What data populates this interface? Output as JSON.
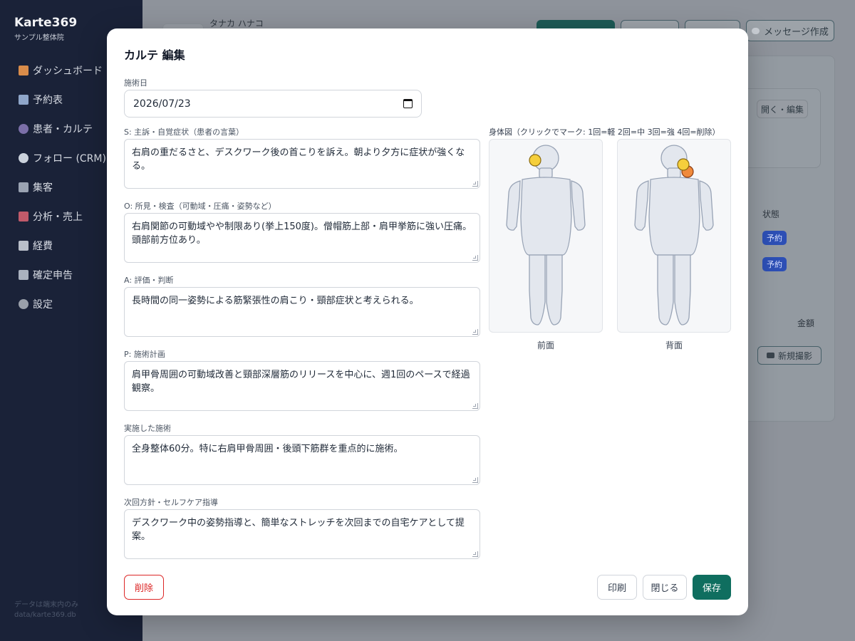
{
  "app": {
    "name": "Karte369",
    "clinic": "サンプル整体院",
    "footer_line1": "データは端末内のみ",
    "footer_line2": "data/karte369.db"
  },
  "sidebar": {
    "items": [
      {
        "label": "ダッシュボード",
        "icon": "house-icon"
      },
      {
        "label": "予約表",
        "icon": "calendar-icon"
      },
      {
        "label": "患者・カルテ",
        "icon": "people-icon"
      },
      {
        "label": "フォロー (CRM)",
        "icon": "chat-icon"
      },
      {
        "label": "集客",
        "icon": "trend-icon"
      },
      {
        "label": "分析・売上",
        "icon": "bar-chart-icon"
      },
      {
        "label": "経費",
        "icon": "receipt-icon"
      },
      {
        "label": "確定申告",
        "icon": "document-icon"
      },
      {
        "label": "設定",
        "icon": "gear-icon"
      }
    ]
  },
  "background": {
    "patient_name": "タナカ ハナコ",
    "message_button": "メッセージ作成",
    "open_edit_button": "開く・編集",
    "status_header": "状態",
    "status_badge": "予約",
    "amount_header": "金額",
    "new_photo_button": "新規撮影"
  },
  "modal": {
    "title": "カルテ 編集",
    "date_label": "施術日",
    "date_value": "2026/07/23",
    "fields": [
      {
        "label": "S: 主訴・自覚症状（患者の言葉）",
        "value": "右肩の重だるさと、デスクワーク後の首こりを訴え。朝より夕方に症状が強くなる。"
      },
      {
        "label": "O: 所見・検査（可動域・圧痛・姿勢など）",
        "value": "右肩関節の可動域やや制限あり(挙上150度)。僧帽筋上部・肩甲挙筋に強い圧痛。頭部前方位あり。"
      },
      {
        "label": "A: 評価・判断",
        "value": "長時間の同一姿勢による筋緊張性の肩こり・頸部症状と考えられる。"
      },
      {
        "label": "P: 施術計画",
        "value": "肩甲骨周囲の可動域改善と頸部深層筋のリリースを中心に、週1回のペースで経過観察。"
      },
      {
        "label": "実施した施術",
        "value": "全身整体60分。特に右肩甲骨周囲・後頭下筋群を重点的に施術。"
      },
      {
        "label": "次回方針・セルフケア指導",
        "value": "デスクワーク中の姿勢指導と、簡単なストレッチを次回までの自宅ケアとして提案。"
      }
    ],
    "body_chart_label": "身体図（クリックでマーク: 1回=軽 2回=中 3回=強 4回=削除）",
    "front_caption": "前面",
    "back_caption": "背面",
    "marker_colors": {
      "light": "#f5cf3c",
      "medium": "#f08a3c"
    },
    "buttons": {
      "delete": "削除",
      "print": "印刷",
      "close": "閉じる",
      "save": "保存"
    }
  }
}
